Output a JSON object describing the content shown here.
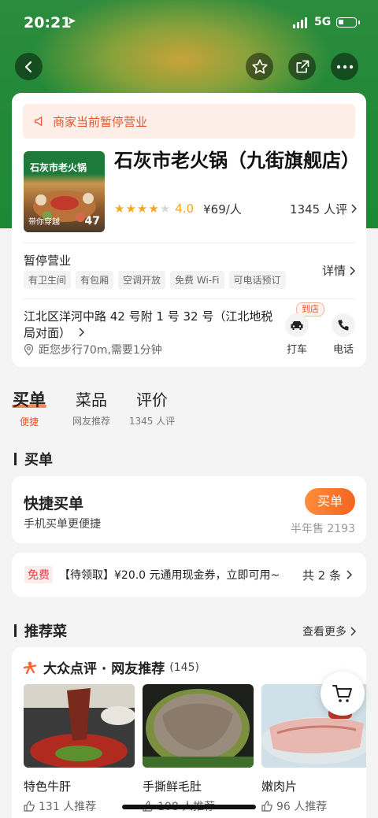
{
  "status_bar": {
    "time": "20:21",
    "network": "5G"
  },
  "notice": {
    "text": "商家当前暂停营业"
  },
  "store": {
    "image_title": "石灰市老火锅",
    "image_bottom_text": "带你穿越",
    "image_photo_count": "47",
    "name": "石灰市老火锅（九街旗舰店）",
    "rating": "4.0",
    "stars_filled": 4,
    "stars_total": 5,
    "price": "¥69/人",
    "reviews_count": "1345 人评",
    "status": "暂停营业",
    "tags": [
      "有卫生间",
      "有包厢",
      "空调开放",
      "免费 Wi-Fi",
      "可电话预订"
    ],
    "details_label": "详情",
    "address": "江北区洋河中路 42 号附 1 号 32 号（江北地税局对面）",
    "distance": "距您步行70m,需要1分钟",
    "to_store_badge": "到店",
    "taxi_label": "打车",
    "phone_label": "电话"
  },
  "tabs": [
    {
      "label": "买单",
      "sub": "便捷"
    },
    {
      "label": "菜品",
      "sub": "网友推荐"
    },
    {
      "label": "评价",
      "sub": "1345 人评"
    }
  ],
  "buy_section": {
    "title": "买单",
    "quick_title": "快捷买单",
    "quick_sub": "手机买单更便捷",
    "buy_button": "买单",
    "sales": "半年售 2193"
  },
  "coupon": {
    "free_tag": "免费",
    "text": "【待领取】¥20.0 元通用现金券，立即可用~",
    "count": "共 2 条"
  },
  "recommend": {
    "title": "推荐菜",
    "more": "查看更多",
    "header": "大众点评 · 网友推荐",
    "header_count": "(145)",
    "dishes": [
      {
        "name": "特色牛肝",
        "likes": "131 人推荐"
      },
      {
        "name": "手撕鲜毛肚",
        "likes": "108 人推荐"
      },
      {
        "name": "嫩肉片",
        "likes": "96 人推荐"
      }
    ]
  },
  "colors": {
    "brand_green": "#1f8a37",
    "accent_orange": "#f4641f",
    "star": "#f5a623"
  }
}
